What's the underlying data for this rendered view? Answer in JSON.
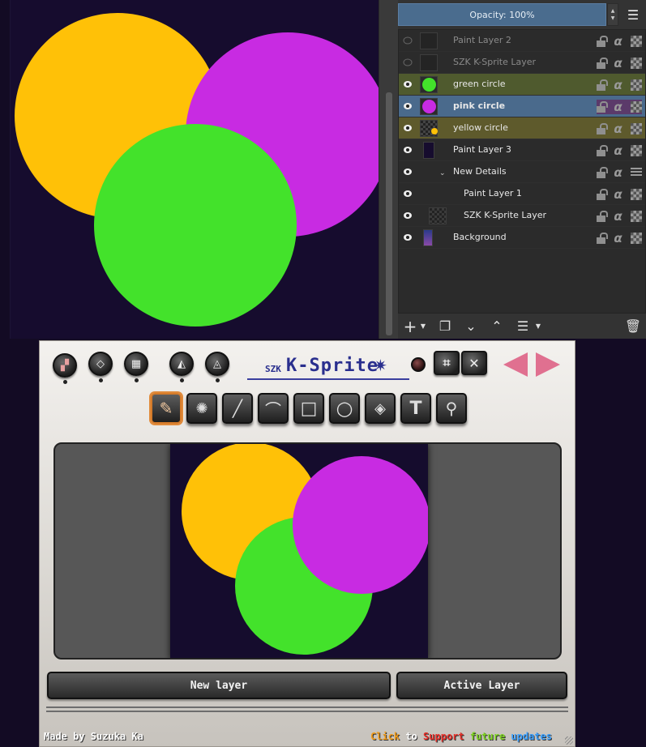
{
  "canvas": {
    "background": "#160c2e",
    "circles": [
      {
        "name": "yellow circle",
        "color": "#ffc107"
      },
      {
        "name": "pink circle",
        "color": "#c82be2"
      },
      {
        "name": "green circle",
        "color": "#43e22b"
      }
    ]
  },
  "docker": {
    "opacity_label": "Opacity:  100%",
    "layers": [
      {
        "name": "Paint Layer 2",
        "visible": false,
        "selected": false,
        "highlight": ""
      },
      {
        "name": "SZK K-Sprite Layer",
        "visible": false,
        "selected": false,
        "highlight": ""
      },
      {
        "name": "green circle",
        "visible": true,
        "selected": false,
        "highlight": "#4f5a2e"
      },
      {
        "name": "pink circle",
        "visible": true,
        "selected": true,
        "highlight": "#4a6a8c"
      },
      {
        "name": "yellow circle",
        "visible": true,
        "selected": false,
        "highlight": "#5e5a2c"
      },
      {
        "name": "Paint Layer 3",
        "visible": true,
        "selected": false,
        "highlight": ""
      },
      {
        "name": "New Details",
        "visible": true,
        "selected": false,
        "highlight": ""
      },
      {
        "name": "Paint Layer 1",
        "visible": true,
        "selected": false,
        "highlight": ""
      },
      {
        "name": "SZK K-Sprite Layer",
        "visible": true,
        "selected": false,
        "highlight": ""
      },
      {
        "name": "Background",
        "visible": true,
        "selected": false,
        "highlight": ""
      }
    ]
  },
  "ksprite": {
    "logo_prefix": "SZK",
    "logo_title": "K-Sprite",
    "new_layer_label": "New layer",
    "active_layer_label": "Active Layer",
    "footer_credit": "Made by Suzuka Ka",
    "support_words": [
      {
        "text": "Click",
        "color": "#f39c1a"
      },
      {
        "text": " to ",
        "color": "#ffffff"
      },
      {
        "text": "Support",
        "color": "#e8302a"
      },
      {
        "text": " future",
        "color": "#7ed321"
      },
      {
        "text": " updates",
        "color": "#3aa0ff"
      }
    ],
    "tools": [
      "brush-tool",
      "spray-tool",
      "line-tool",
      "curve-tool",
      "rectangle-tool",
      "ellipse-tool",
      "fill-tool",
      "text-tool",
      "zoom-tool"
    ]
  }
}
